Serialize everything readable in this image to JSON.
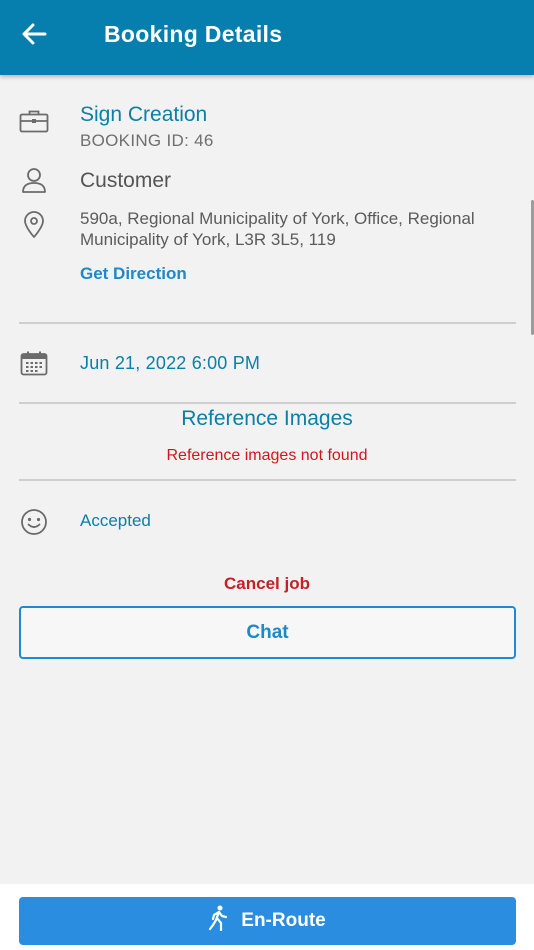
{
  "header": {
    "title": "Booking Details",
    "back_icon": "arrow-left-icon"
  },
  "booking": {
    "service_name": "Sign Creation",
    "booking_id": "BOOKING ID: 46",
    "customer": "Customer",
    "address": "590a, Regional Municipality of York, Office, Regional Municipality of York, L3R 3L5, 119",
    "get_direction": "Get Direction",
    "datetime": "Jun 21, 2022 6:00 PM",
    "status": "Accepted"
  },
  "reference": {
    "title": "Reference Images",
    "empty_message": "Reference images not found"
  },
  "actions": {
    "cancel_label": "Cancel job",
    "chat_label": "Chat",
    "enroute_label": "En-Route"
  },
  "icons": {
    "briefcase": "briefcase-icon",
    "person": "person-icon",
    "location": "location-pin-icon",
    "calendar": "calendar-icon",
    "status": "smiley-icon",
    "walk": "walking-person-icon"
  },
  "colors": {
    "appbar": "#067fae",
    "accent": "#0a7fa8",
    "link": "#1f88c9",
    "danger": "#c62026",
    "primary_button": "#2a8de0"
  }
}
